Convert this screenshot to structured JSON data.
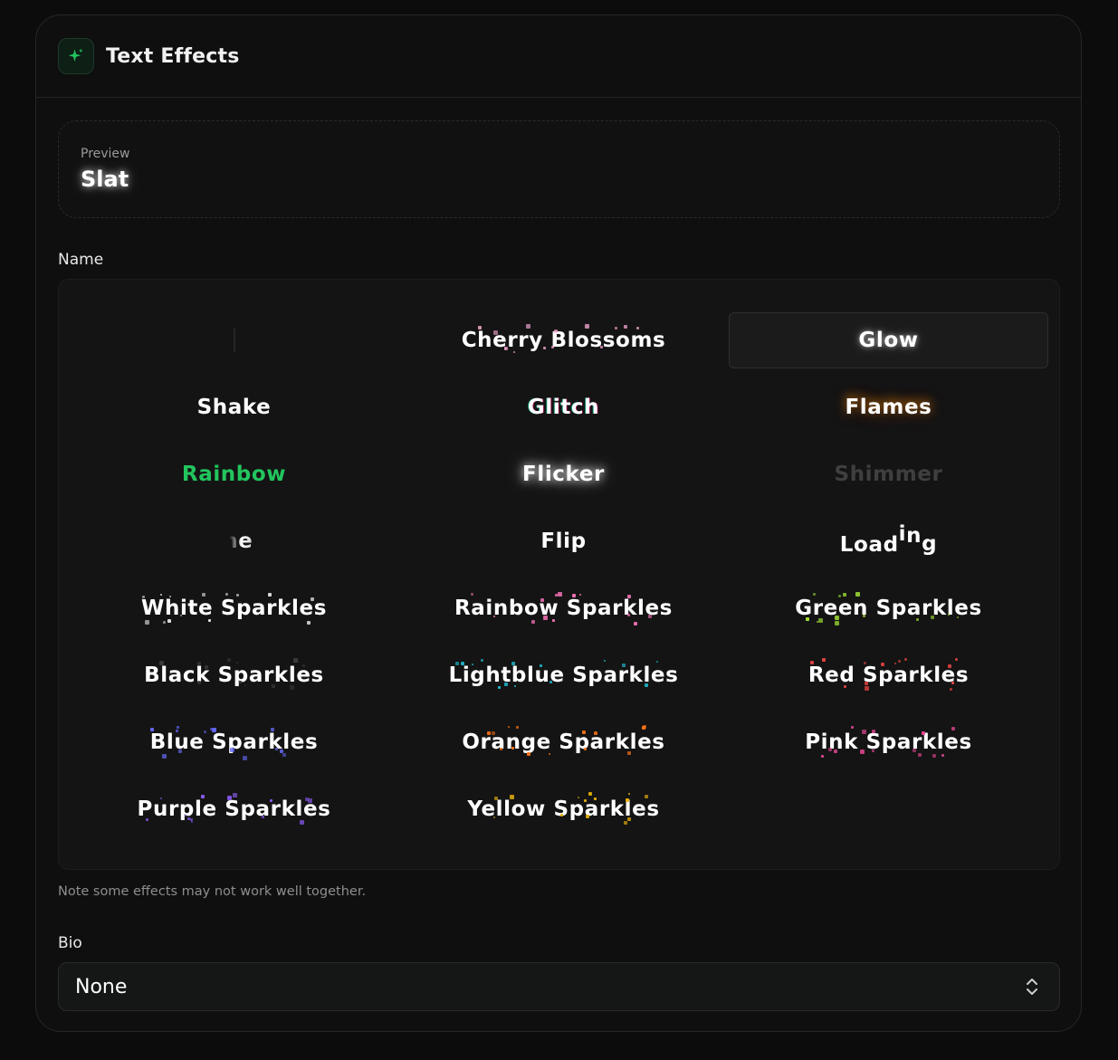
{
  "header": {
    "title": "Text Effects",
    "icon": "sparkle-icon",
    "accent": "#22c55e"
  },
  "preview": {
    "label": "Preview",
    "text": "Slat"
  },
  "name_field": {
    "label": "Name",
    "selected": "Glow",
    "effects": [
      {
        "label": "",
        "style": "blank"
      },
      {
        "label": "Cherry Blossoms",
        "style": "sparkles",
        "color": "#f9a8d4"
      },
      {
        "label": "Glow",
        "style": "glow"
      },
      {
        "label": "Shake",
        "style": "plain"
      },
      {
        "label": "Glitch",
        "style": "glitch"
      },
      {
        "label": "Flames",
        "style": "flames"
      },
      {
        "label": "Rainbow",
        "style": "rainbow",
        "color": "#22c55e"
      },
      {
        "label": "Flicker",
        "style": "flicker"
      },
      {
        "label": "Shimmer",
        "style": "shimmer"
      },
      {
        "label": "ine",
        "style": "shine"
      },
      {
        "label": "Flip",
        "style": "flip"
      },
      {
        "label": "Loading",
        "style": "loading"
      },
      {
        "label": "White Sparkles",
        "style": "sparkles",
        "color": "#e5e5e5"
      },
      {
        "label": "Rainbow Sparkles",
        "style": "sparkles",
        "color": "#f472b6"
      },
      {
        "label": "Green Sparkles",
        "style": "sparkles",
        "color": "#a3e635"
      },
      {
        "label": "Black Sparkles",
        "style": "sparkles",
        "color": "#3a3a3a"
      },
      {
        "label": "Lightblue Sparkles",
        "style": "sparkles",
        "color": "#22d3ee"
      },
      {
        "label": "Red Sparkles",
        "style": "sparkles",
        "color": "#ef4444"
      },
      {
        "label": "Blue Sparkles",
        "style": "sparkles",
        "color": "#6366f1"
      },
      {
        "label": "Orange Sparkles",
        "style": "sparkles",
        "color": "#f97316"
      },
      {
        "label": "Pink Sparkles",
        "style": "sparkles",
        "color": "#ec4899"
      },
      {
        "label": "Purple Sparkles",
        "style": "sparkles",
        "color": "#8b5cf6"
      },
      {
        "label": "Yellow Sparkles",
        "style": "sparkles",
        "color": "#eab308"
      }
    ]
  },
  "note": "Note some effects may not work well together.",
  "bio_field": {
    "label": "Bio",
    "value": "None",
    "icon": "chevron-up-down-icon"
  }
}
